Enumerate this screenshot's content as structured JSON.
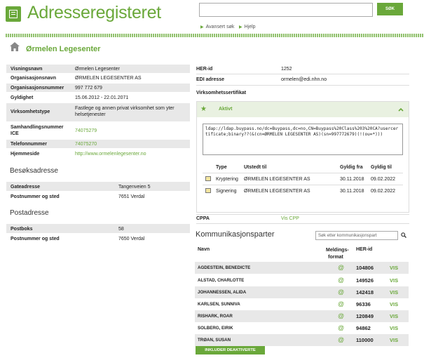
{
  "header": {
    "app_title": "Adresseregisteret",
    "search_value": "",
    "search_button": "SØK",
    "links": [
      "Avansert søk",
      "Hjelp"
    ]
  },
  "page": {
    "title": "Ørmelen Legesenter"
  },
  "details": [
    {
      "label": "Visningsnavn",
      "value": "Ørmelen Legesenter"
    },
    {
      "label": "Organisasjonsnavn",
      "value": "ØRMELEN LEGESENTER AS"
    },
    {
      "label": "Organisasjonsnummer",
      "value": "997 772 679"
    },
    {
      "label": "Gyldighet",
      "value": "15.06.2012 - 22.01.2071"
    },
    {
      "label": "Virksomhetstype",
      "value": "Fastlege og annen privat virksomhet som yter helsetjenester"
    },
    {
      "label": "Samhandlingsnummer ICE",
      "value": "74075279"
    },
    {
      "label": "Telefonnummer",
      "value": "74075270"
    },
    {
      "label": "Hjemmeside",
      "value": "http://www.ormelenlegesenter.no"
    }
  ],
  "visit_address": {
    "title": "Besøksadresse",
    "rows": [
      {
        "label": "Gateadresse",
        "value": "Tangenveien 5"
      },
      {
        "label": "Postnummer og sted",
        "value": "7651 Verdal"
      }
    ]
  },
  "post_address": {
    "title": "Postadresse",
    "rows": [
      {
        "label": "Postboks",
        "value": "58"
      },
      {
        "label": "Postnummer og sted",
        "value": "7650 Verdal"
      }
    ]
  },
  "her_id": {
    "label": "HER-id",
    "value": "1252"
  },
  "edi": {
    "label": "EDI adresse",
    "value": "ormelen@edi.nhn.no"
  },
  "certificate": {
    "section_label": "Virksomhetssertifikat",
    "status": "Aktivt",
    "ldap": "ldap://ldap.buypass.no/dc=Buypass,dc=no,CN=Buypass%20Class%203%20CA?usercertificate;binary??(&(cn=ØRMELEN LEGESENTER AS)(sn=997772679)(!(ou=*)))",
    "columns": [
      "Type",
      "Utstedt til",
      "Gyldig fra",
      "Gyldig til"
    ],
    "rows": [
      {
        "type": "Kryptering",
        "issued_to": "ØRMELEN LEGESENTER AS",
        "from": "30.11.2018",
        "to": "09.02.2022"
      },
      {
        "type": "Signering",
        "issued_to": "ØRMELEN LEGESENTER AS",
        "from": "30.11.2018",
        "to": "09.02.2022"
      }
    ]
  },
  "cppa": {
    "label": "CPPA",
    "link": "Vis CPP"
  },
  "comm": {
    "title": "Kommunikasjonsparter",
    "search_placeholder": "Søk etter kommunikasjonspart",
    "columns": {
      "name": "Navn",
      "format": "Meldings-\nformat",
      "her": "HER-id"
    },
    "rows": [
      {
        "name": "AGDESTEIN, BENEDICTE",
        "format": "@",
        "her": "104806",
        "action": "VIS"
      },
      {
        "name": "ALSTAD, CHARLOTTE",
        "format": "@",
        "her": "149526",
        "action": "VIS"
      },
      {
        "name": "JOHANNESSEN, ALIDA",
        "format": "@",
        "her": "142418",
        "action": "VIS"
      },
      {
        "name": "KARLSEN, SUNNIVA",
        "format": "@",
        "her": "96336",
        "action": "VIS"
      },
      {
        "name": "RISHARK, ROAR",
        "format": "@",
        "her": "120849",
        "action": "VIS"
      },
      {
        "name": "SOLBERG, EIRIK",
        "format": "@",
        "her": "94862",
        "action": "VIS"
      },
      {
        "name": "TRØAN, SUSAN",
        "format": "@",
        "her": "110000",
        "action": "VIS"
      }
    ],
    "include_button": "INKLUDER DEAKTIVERTE"
  },
  "colors": {
    "accent": "#6aa83a",
    "row_shade": "#e8e8e8"
  }
}
